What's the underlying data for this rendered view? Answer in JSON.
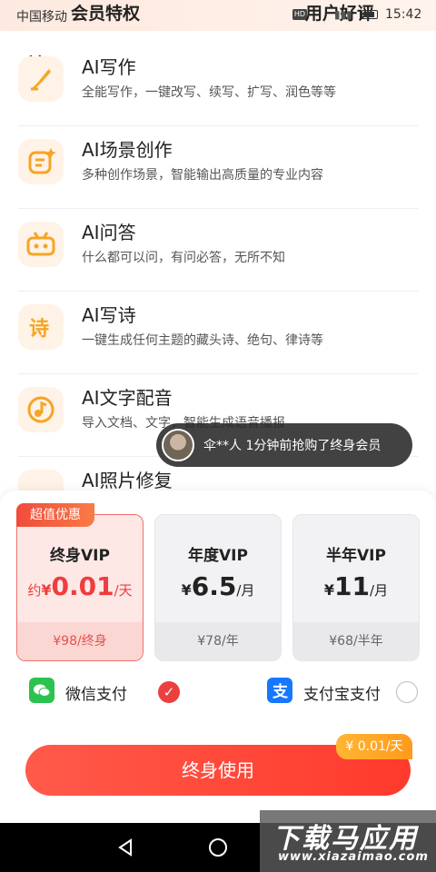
{
  "status_bar": {
    "carrier": "中国移动",
    "overlay_left": "会员特权",
    "overlay_right": "用户好评",
    "signal": "ᵃˡˡ",
    "time": "15:42"
  },
  "features": [
    {
      "title": "AI写作",
      "desc": "全能写作，一键改写、续写、扩写、润色等等",
      "icon": "pen-icon"
    },
    {
      "title": "AI场景创作",
      "desc": "多种创作场景，智能输出高质量的专业内容",
      "icon": "scene-icon"
    },
    {
      "title": "AI问答",
      "desc": "什么都可以问，有问必答，无所不知",
      "icon": "chat-icon"
    },
    {
      "title": "AI写诗",
      "desc": "一键生成任何主题的藏头诗、绝句、律诗等",
      "icon": "poem-icon"
    },
    {
      "title": "AI文字配音",
      "desc": "导入文档、文字，智能生成语音播报",
      "icon": "voice-icon"
    },
    {
      "title": "AI照片修复",
      "desc": "",
      "icon": "photo-icon"
    }
  ],
  "toast": {
    "text": "伞**人  1分钟前抢购了终身会员"
  },
  "badge": "超值优惠",
  "plans": [
    {
      "name": "终身VIP",
      "prefix": "约",
      "currency": "¥",
      "price": "0.01",
      "unit": "/天",
      "original": "¥98/终身",
      "selected": true
    },
    {
      "name": "年度VIP",
      "prefix": "",
      "currency": "¥",
      "price": "6.5",
      "unit": "/月",
      "original": "¥78/年",
      "selected": false
    },
    {
      "name": "半年VIP",
      "prefix": "",
      "currency": "¥",
      "price": "11",
      "unit": "/月",
      "original": "¥68/半年",
      "selected": false
    }
  ],
  "payment": {
    "wechat": {
      "label": "微信支付",
      "selected": true
    },
    "alipay": {
      "label": "支付宝支付",
      "selected": false
    }
  },
  "cta": {
    "label": "终身使用",
    "tag": "¥ 0.01/天"
  },
  "watermark": {
    "line1": "下载马应用",
    "line2": "www.xiazaimao.com"
  },
  "colors": {
    "accent": "#ef3c3c",
    "orange": "#f5a524",
    "wechat": "#2bc24f",
    "alipay": "#1677ff"
  }
}
